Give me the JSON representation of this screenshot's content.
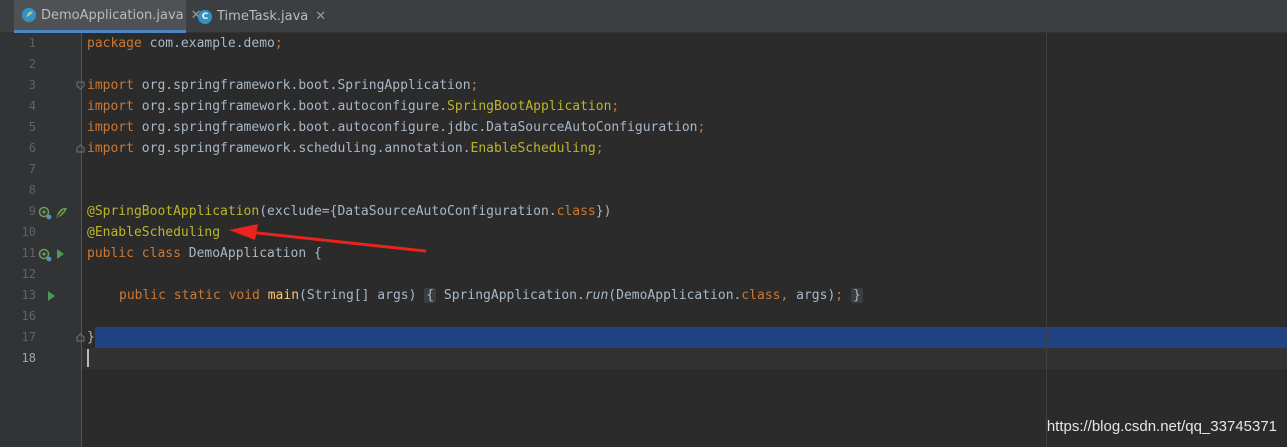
{
  "tabs": [
    {
      "label": "DemoApplication.java",
      "active": true,
      "icon": "spring-class-icon"
    },
    {
      "label": "TimeTask.java",
      "active": false,
      "icon": "class-icon"
    }
  ],
  "tab_close_glyph": "✕",
  "class_icon_letter": "C",
  "lines": [
    {
      "n": "1"
    },
    {
      "n": "2"
    },
    {
      "n": "3"
    },
    {
      "n": "4"
    },
    {
      "n": "5"
    },
    {
      "n": "6"
    },
    {
      "n": "7"
    },
    {
      "n": "8"
    },
    {
      "n": "9"
    },
    {
      "n": "10"
    },
    {
      "n": "11"
    },
    {
      "n": "12"
    },
    {
      "n": "13"
    },
    {
      "n": "16"
    },
    {
      "n": "17"
    },
    {
      "n": "18"
    }
  ],
  "code": {
    "l1_kw": "package",
    "l1_rest": " com.example.demo",
    "l1_semi": ";",
    "import_kw": "import",
    "l3_rest": " org.springframework.boot.SpringApplication",
    "l4_pre": " org.springframework.boot.autoconfigure.",
    "l4_cls": "SpringBootApplication",
    "l5_rest": " org.springframework.boot.autoconfigure.jdbc.DataSourceAutoConfiguration",
    "l6_pre": " org.springframework.scheduling.annotation.",
    "l6_cls": "EnableScheduling",
    "semi": ";",
    "l9_ann": "@SpringBootApplication",
    "l9_open": "(exclude={DataSourceAutoConfiguration.",
    "l9_class": "class",
    "l9_close": "})",
    "l10_ann": "@EnableScheduling",
    "l11_kw": "public class",
    "l11_rest": " DemoApplication {",
    "l13_kw": "public static void",
    "l13_main": "main",
    "l13_args": "(String[] args)",
    "l13_lbrace": "{",
    "l13_call": " SpringApplication.",
    "l13_run": "run",
    "l13_call2": "(DemoApplication.",
    "l13_class": "class",
    "l13_comma": ",",
    "l13_argsend": " args)",
    "l13_semi": ";",
    "l13_rbrace": "}",
    "l17": "}"
  },
  "watermark": "https://blog.csdn.net/qq_33745371",
  "colors": {
    "keyword": "#cc7832",
    "annotation": "#bbb529",
    "method": "#ffc66d",
    "text": "#a9b7c6",
    "selection": "#214283",
    "arrow": "#e8241c"
  }
}
